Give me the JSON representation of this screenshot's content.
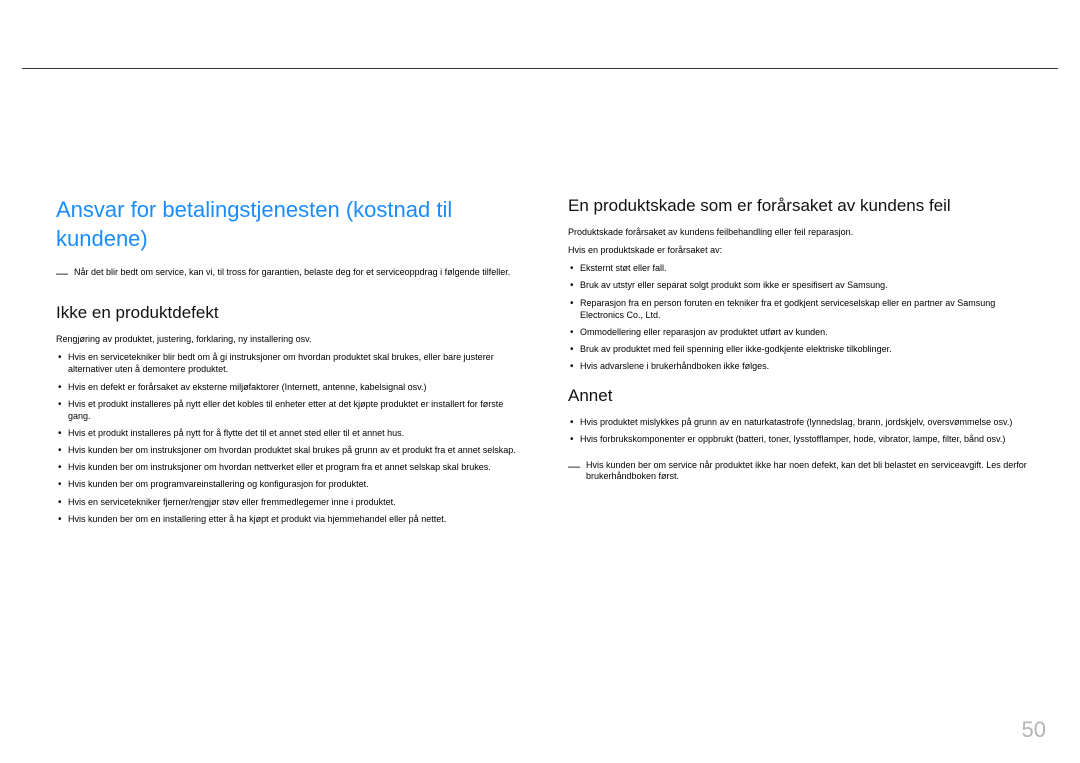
{
  "page_number": "50",
  "left": {
    "title": "Ansvar for betalingstjenesten (kostnad til kundene)",
    "note": "Når det blir bedt om service, kan vi, til tross for garantien, belaste deg for et serviceoppdrag i følgende tilfeller.",
    "sub1": "Ikke en produktdefekt",
    "intro": "Rengjøring av produktet, justering, forklaring, ny installering osv.",
    "items": [
      "Hvis en servicetekniker blir bedt om å gi instruksjoner om hvordan produktet skal brukes, eller bare justerer alternativer uten å demontere produktet.",
      "Hvis en defekt er forårsaket av eksterne miljøfaktorer (Internett, antenne, kabelsignal osv.)",
      "Hvis et produkt installeres på nytt eller det kobles til enheter etter at det kjøpte produktet er installert for første gang.",
      "Hvis et produkt installeres på nytt for å flytte det til et annet sted eller til et annet hus.",
      "Hvis kunden ber om instruksjoner om hvordan produktet skal brukes på grunn av et produkt fra et annet selskap.",
      "Hvis kunden ber om instruksjoner om hvordan nettverket eller et program fra et annet selskap skal brukes.",
      "Hvis kunden ber om programvareinstallering og konfigurasjon for produktet.",
      "Hvis en servicetekniker fjerner/rengjør støv eller fremmedlegemer inne i produktet.",
      "Hvis kunden ber om en installering etter å ha kjøpt et produkt via hjemmehandel eller på nettet."
    ]
  },
  "right": {
    "sub1": "En produktskade som er forårsaket av kundens feil",
    "intro1": "Produktskade forårsaket av kundens feilbehandling eller feil reparasjon.",
    "intro2": "Hvis en produktskade er forårsaket av:",
    "items1": [
      "Eksternt støt eller fall.",
      "Bruk av utstyr eller separat solgt produkt som ikke er spesifisert av Samsung.",
      "Reparasjon fra en person foruten en tekniker fra et godkjent serviceselskap eller en partner av Samsung Electronics Co., Ltd.",
      "Ommodellering eller reparasjon av produktet utført av kunden.",
      "Bruk av produktet med feil spenning eller ikke-godkjente elektriske tilkoblinger.",
      "Hvis advarslene i brukerhåndboken ikke følges."
    ],
    "sub2": "Annet",
    "items2": [
      "Hvis produktet mislykkes på grunn av en naturkatastrofe (lynnedslag, brann, jordskjelv, oversvømmelse osv.)",
      "Hvis forbrukskomponenter er oppbrukt (batteri, toner, lysstofflamper, hode, vibrator, lampe, filter, bånd osv.)"
    ],
    "note2": "Hvis kunden ber om service når produktet ikke har noen defekt, kan det bli belastet en serviceavgift. Les derfor brukerhåndboken først."
  }
}
